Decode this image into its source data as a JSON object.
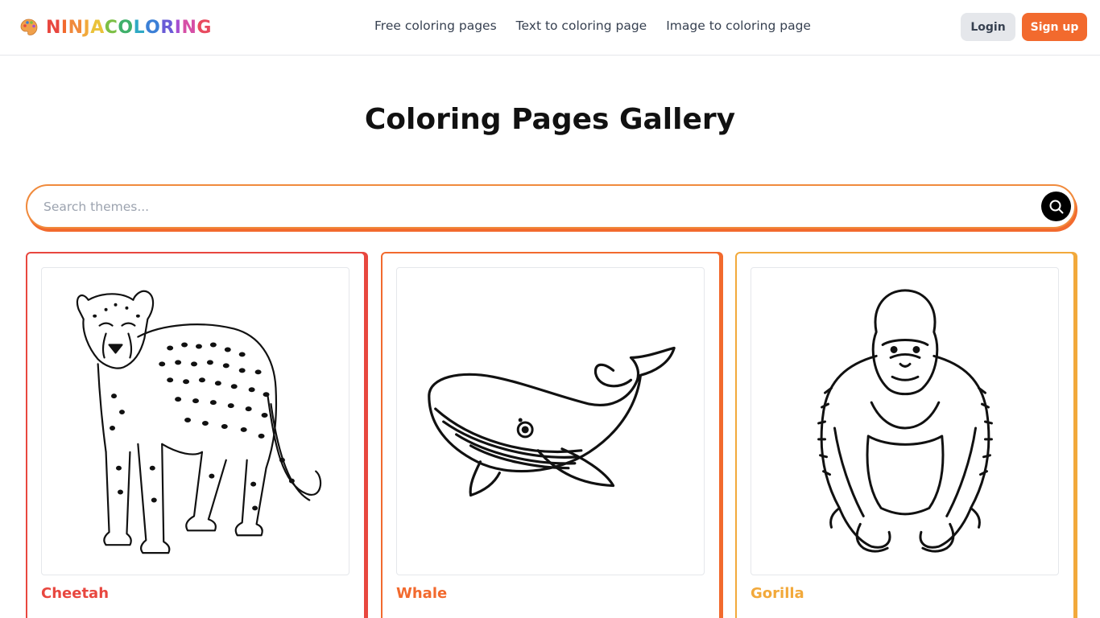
{
  "header": {
    "logo_text": "NINJACOLORING",
    "logo_letter_colors": [
      "#e8473f",
      "#f26a2e",
      "#f08a3c",
      "#f2a93b",
      "#eac23a",
      "#7cbf45",
      "#3fb06a",
      "#2fa9c4",
      "#3b7fd6",
      "#6a5bd6",
      "#a64fd0",
      "#d64fa6",
      "#e84a5f"
    ],
    "nav": [
      {
        "label": "Free coloring pages"
      },
      {
        "label": "Text to coloring page"
      },
      {
        "label": "Image to coloring page"
      }
    ],
    "login_label": "Login",
    "signup_label": "Sign up"
  },
  "main": {
    "title": "Coloring Pages Gallery",
    "search": {
      "placeholder": "Search themes...",
      "value": "",
      "icon": "search-icon"
    },
    "cards": [
      {
        "title": "Cheetah",
        "color": "#e8473f",
        "image": "cheetah-line-drawing"
      },
      {
        "title": "Whale",
        "color": "#f26a2e",
        "image": "whale-line-drawing"
      },
      {
        "title": "Gorilla",
        "color": "#f2a93b",
        "image": "gorilla-line-drawing"
      }
    ]
  },
  "colors": {
    "accent": "#f26a2e",
    "login_bg": "#e5e7eb",
    "nav_text": "#374151"
  }
}
